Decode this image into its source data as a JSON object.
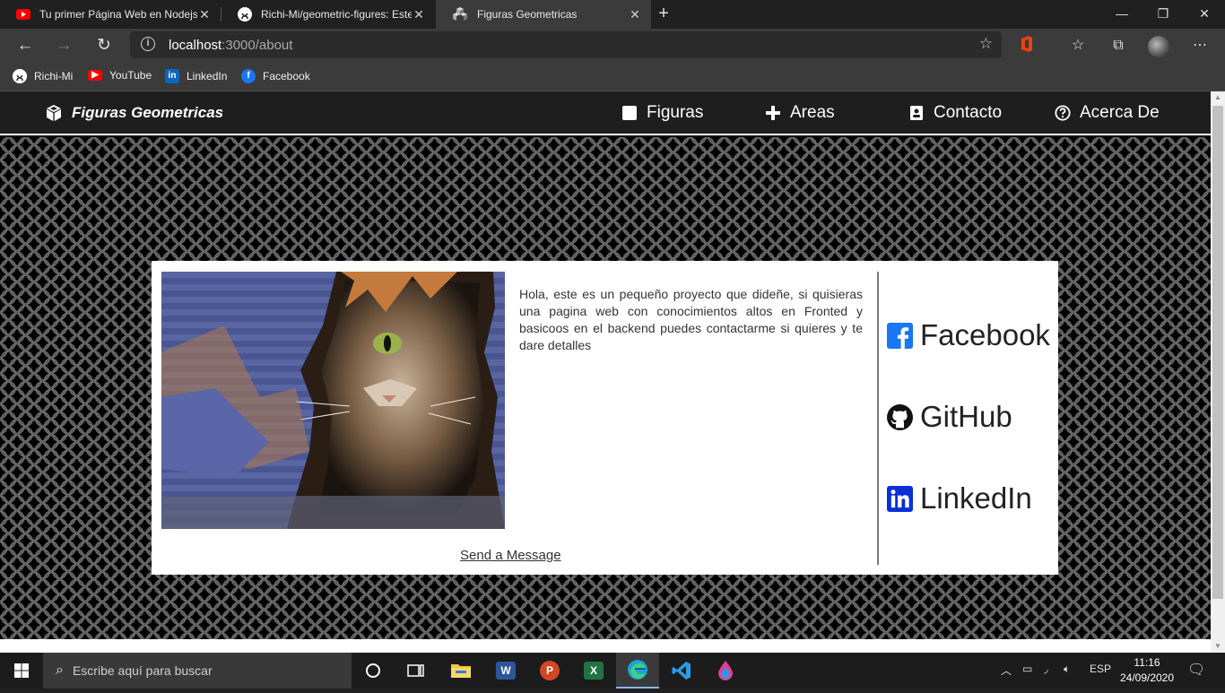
{
  "browser": {
    "tabs": [
      {
        "title": "Tu primer Página Web en Nodejs",
        "icon": "youtube-icon"
      },
      {
        "title": "Richi-Mi/geometric-figures: Este",
        "icon": "github-icon"
      },
      {
        "title": "Figuras Geometricas",
        "icon": "cube-icon",
        "active": true
      }
    ],
    "address": {
      "host": "localhost",
      "path": ":3000/about"
    },
    "favorites": [
      {
        "label": "Richi-Mi",
        "icon": "github-icon"
      },
      {
        "label": "YouTube",
        "icon": "youtube-icon"
      },
      {
        "label": "LinkedIn",
        "icon": "linkedin-icon"
      },
      {
        "label": "Facebook",
        "icon": "facebook-icon"
      }
    ]
  },
  "site": {
    "brand": "Figuras Geometricas",
    "nav": [
      {
        "label": "Figuras",
        "icon": "square-icon"
      },
      {
        "label": "Areas",
        "icon": "plus-icon"
      },
      {
        "label": "Contacto",
        "icon": "contact-card-icon"
      },
      {
        "label": "Acerca De",
        "icon": "question-circle-icon"
      }
    ],
    "about": {
      "description": "Hola, este es un pequeño proyecto que dideñe, si quisieras una pagina web con conocimientos altos en Fronted y basicoos en el backend puedes contactarme si quieres y te dare detalles",
      "send_message": "Send a Message",
      "social": [
        {
          "label": "Facebook",
          "icon": "facebook-square-icon"
        },
        {
          "label": "GitHub",
          "icon": "github-icon"
        },
        {
          "label": "LinkedIn",
          "icon": "linkedin-square-icon"
        }
      ]
    }
  },
  "taskbar": {
    "search_placeholder": "Escribe aquí para buscar",
    "language": "ESP",
    "time": "11:16",
    "date": "24/09/2020"
  },
  "colors": {
    "accent_facebook": "#1877f2",
    "accent_linkedin": "#0a66c2",
    "accent_youtube": "#ff0000",
    "nav_bg": "#1e1e1e"
  }
}
